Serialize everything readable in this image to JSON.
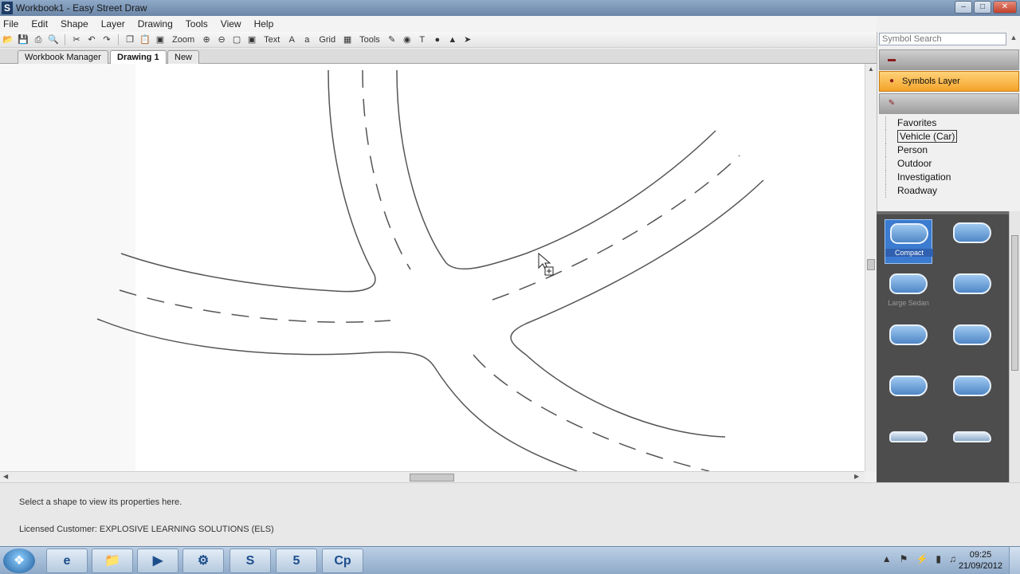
{
  "window": {
    "title": "Workbook1 - Easy Street Draw",
    "app_icon": "S"
  },
  "window_buttons": [
    "–",
    "□",
    "✕"
  ],
  "menu": [
    "File",
    "Edit",
    "Shape",
    "Layer",
    "Drawing",
    "Tools",
    "View",
    "Help"
  ],
  "toolbar": {
    "zoom_label": "Zoom",
    "text_label": "Text",
    "grid_label": "Grid",
    "tools_label": "Tools"
  },
  "tabs": {
    "workbook_manager": "Workbook Manager",
    "drawing1": "Drawing 1",
    "new": "New"
  },
  "status": {
    "hint": "Select a shape to view its properties here.",
    "license": "Licensed Customer: EXPLOSIVE LEARNING SOLUTIONS (ELS)"
  },
  "panel": {
    "search_placeholder": "Symbol Search",
    "layers": {
      "symbols_layer": "Symbols Layer"
    },
    "categories": [
      "Favorites",
      "Vehicle (Car)",
      "Person",
      "Outdoor",
      "Investigation",
      "Roadway"
    ],
    "selected_category": "Vehicle (Car)",
    "symbols": [
      "Compact",
      "",
      "Large Sedan",
      "",
      "",
      "",
      "",
      "",
      "",
      ""
    ]
  },
  "taskbar": {
    "time": "09:25",
    "date": "21/09/2012"
  },
  "colors": {
    "symbols_layer_active": "#f3a32a",
    "symbol_panel_bg": "#4d4d4d",
    "road_line": "#555555"
  }
}
